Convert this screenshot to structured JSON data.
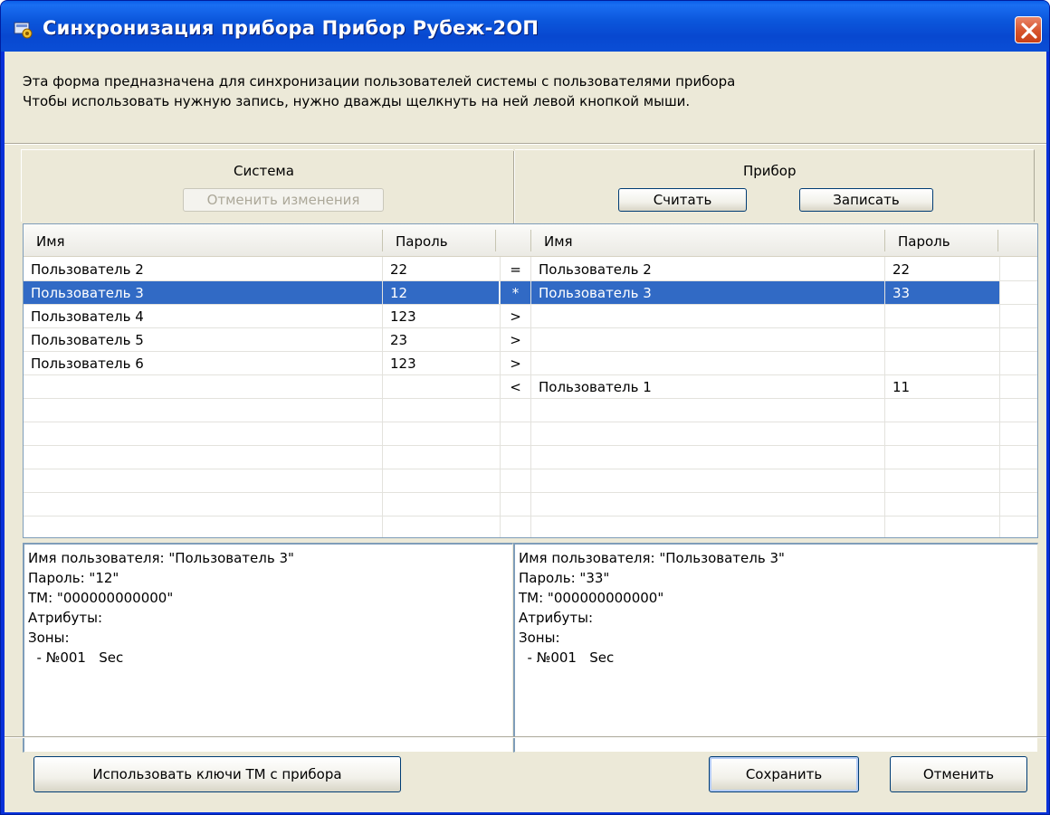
{
  "window": {
    "title": "Синхронизация прибора Прибор Рубеж-2ОП"
  },
  "info": {
    "line1": "Эта форма предназначена для синхронизации пользователей системы с пользователями прибора",
    "line2": "Чтобы использовать нужную запись, нужно дважды щелкнуть на ней левой кнопкой мыши."
  },
  "system": {
    "title": "Система",
    "cancel_changes_label": "Отменить изменения"
  },
  "device": {
    "title": "Прибор",
    "read_label": "Считать",
    "write_label": "Записать"
  },
  "grid": {
    "headers": {
      "name_left": "Имя",
      "pass_left": "Пароль",
      "name_right": "Имя",
      "pass_right": "Пароль"
    },
    "rows": [
      {
        "name_left": "Пользователь 2",
        "pass_left": "22",
        "mark": "=",
        "name_right": "Пользователь 2",
        "pass_right": "22"
      },
      {
        "name_left": "Пользователь 3",
        "pass_left": "12",
        "mark": "*",
        "name_right": "Пользователь 3",
        "pass_right": "33"
      },
      {
        "name_left": "Пользователь 4",
        "pass_left": "123",
        "mark": ">",
        "name_right": "",
        "pass_right": ""
      },
      {
        "name_left": "Пользователь 5",
        "pass_left": "23",
        "mark": ">",
        "name_right": "",
        "pass_right": ""
      },
      {
        "name_left": "Пользователь 6",
        "pass_left": "123",
        "mark": ">",
        "name_right": "",
        "pass_right": ""
      },
      {
        "name_left": "",
        "pass_left": "",
        "mark": "<",
        "name_right": "Пользователь 1",
        "pass_right": "11"
      }
    ],
    "selected_index": 1
  },
  "details_left": {
    "user": "Имя пользователя: \"Пользователь 3\"",
    "password": "Пароль: \"12\"",
    "tm": "ТМ: \"000000000000\"",
    "attributes": "Атрибуты:",
    "zones": "Зоны:",
    "zone1": "  - №001   Sec"
  },
  "details_right": {
    "user": "Имя пользователя: \"Пользователь 3\"",
    "password": "Пароль: \"33\"",
    "tm": "ТМ: \"000000000000\"",
    "attributes": "Атрибуты:",
    "zones": "Зоны:",
    "zone1": "  - №001   Sec"
  },
  "footer": {
    "use_tm_keys_label": "Использовать ключи ТМ  с прибора",
    "save_label": "Сохранить",
    "cancel_label": "Отменить"
  },
  "colors": {
    "selection": "#316ac5",
    "titlebar": "#0b56db",
    "face": "#ece9d8"
  }
}
